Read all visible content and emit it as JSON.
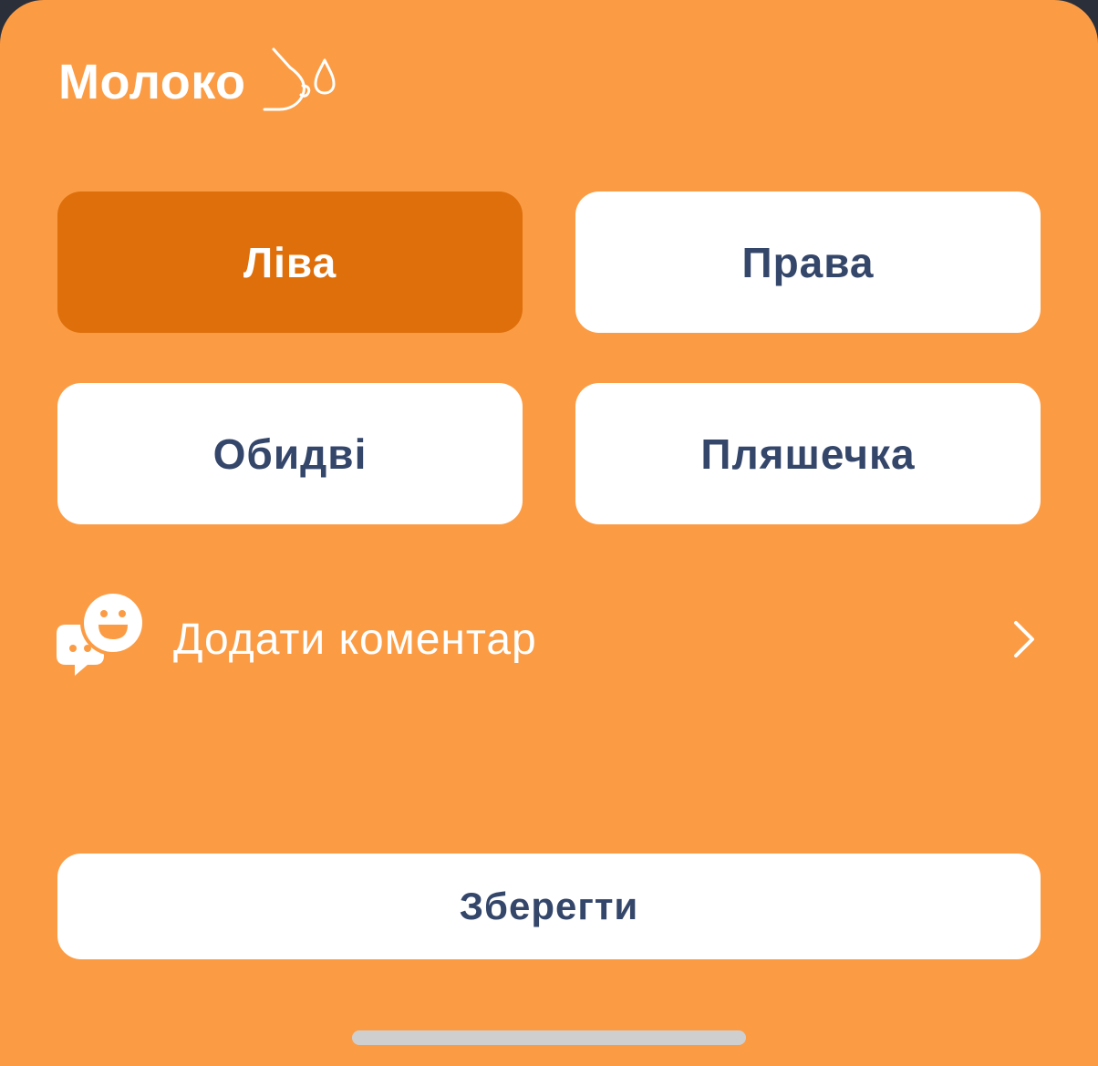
{
  "header": {
    "title": "Молоко",
    "icon": "breast-milk-icon"
  },
  "options": [
    {
      "label": "Ліва",
      "selected": true
    },
    {
      "label": "Права",
      "selected": false
    },
    {
      "label": "Обидві",
      "selected": false
    },
    {
      "label": "Пляшечка",
      "selected": false
    }
  ],
  "comment": {
    "label": "Додати коментар",
    "icon": "comment-smile-icon",
    "chevron": "chevron-right-icon"
  },
  "save": {
    "label": "Зберегти"
  },
  "colors": {
    "background": "#fb9c45",
    "selected": "#de6f0a",
    "button_text": "#34466a",
    "white": "#ffffff"
  }
}
